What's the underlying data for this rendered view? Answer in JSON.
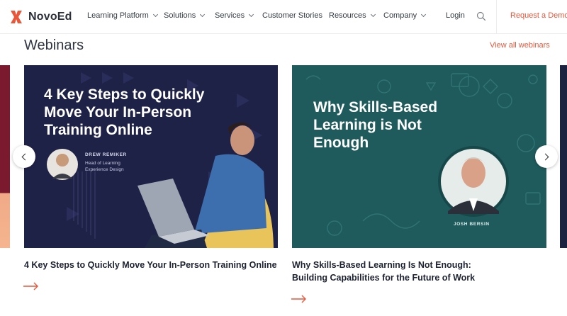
{
  "brand": {
    "name": "NovoEd",
    "accent": "#e8573a"
  },
  "nav": {
    "items": [
      {
        "label": "Learning Platform",
        "dropdown": true
      },
      {
        "label": "Solutions",
        "dropdown": true
      },
      {
        "label": "Services",
        "dropdown": true
      },
      {
        "label": "Customer Stories",
        "dropdown": false
      },
      {
        "label": "Resources",
        "dropdown": true
      },
      {
        "label": "Company",
        "dropdown": true
      }
    ],
    "login": "Login",
    "search_icon": "search-icon",
    "cta": "Request a Demo"
  },
  "section": {
    "title": "Webinars",
    "view_all": "View all webinars"
  },
  "cards": [
    {
      "image_headline": "4 Key Steps to Quickly Move Your In-Person Training Online",
      "speaker_name": "DREW REMIKER",
      "speaker_role": "Head of Learning Experience Design",
      "title": "4 Key Steps to Quickly Move Your In-Person Training Online",
      "image_bg": "#1f2247"
    },
    {
      "image_headline": "Why Skills-Based Learning is Not Enough",
      "speaker_name": "JOSH BERSIN",
      "title": "Why Skills-Based Learning Is Not Enough: Building Capabilities for the Future of Work",
      "image_bg": "#1f5b5c"
    }
  ],
  "carousel": {
    "prev_icon": "chevron-left-icon",
    "next_icon": "chevron-right-icon"
  }
}
